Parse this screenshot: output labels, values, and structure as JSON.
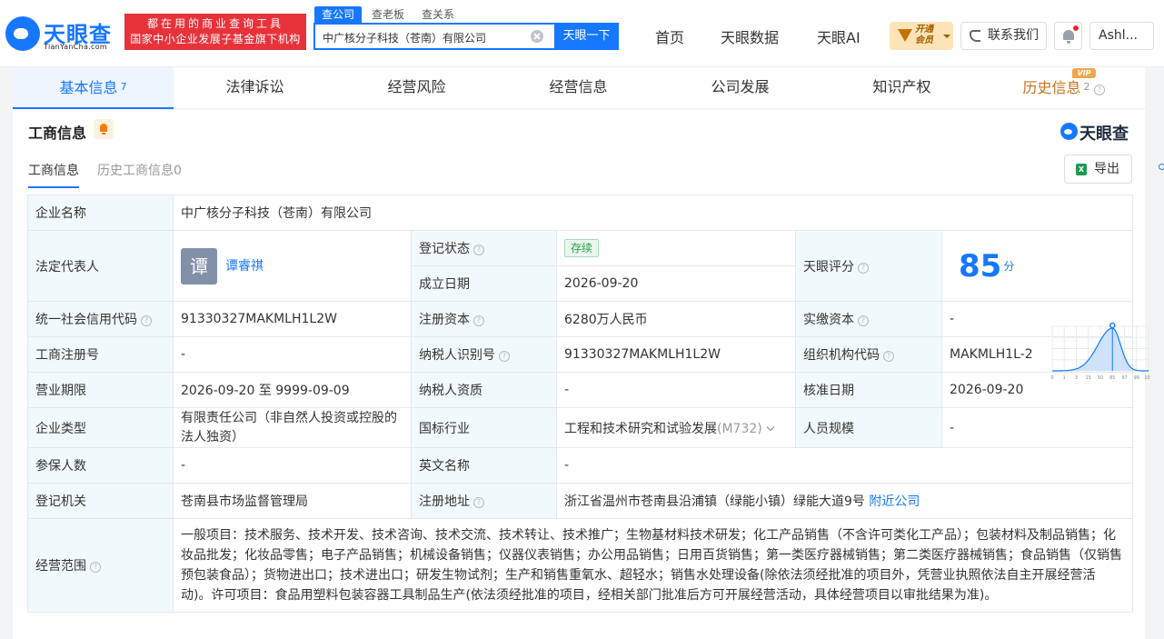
{
  "brand": {
    "name": "天眼查",
    "domain": "TianYanCha.com",
    "slogan_line1": "都在用的商业查询工具",
    "slogan_line2": "国家中小企业发展子基金旗下机构"
  },
  "search": {
    "tabs": [
      "查公司",
      "查老板",
      "查关系"
    ],
    "value": "中广核分子科技（苍南）有限公司",
    "button": "天眼一下"
  },
  "nav": {
    "links": [
      "首页",
      "天眼数据",
      "天眼AI"
    ],
    "vip_line1": "开通",
    "vip_line2": "会员",
    "contact": "联系我们",
    "user": "Ashl..."
  },
  "main_tabs": [
    {
      "label": "基本信息",
      "count": "7"
    },
    {
      "label": "法律诉讼",
      "count": ""
    },
    {
      "label": "经营风险",
      "count": ""
    },
    {
      "label": "经营信息",
      "count": ""
    },
    {
      "label": "公司发展",
      "count": ""
    },
    {
      "label": "知识产权",
      "count": ""
    },
    {
      "label": "历史信息",
      "count": "2"
    }
  ],
  "vip_tag": "VIP",
  "section": {
    "title": "工商信息",
    "sub_tab_active": "工商信息",
    "sub_tab_history": "历史工商信息0",
    "export": "导出",
    "excel_glyph": "X"
  },
  "info": {
    "company_name_label": "企业名称",
    "company_name": "中广核分子科技（苍南）有限公司",
    "legal_rep_label": "法定代表人",
    "legal_rep_avatar": "谭",
    "legal_rep": "谭睿祺",
    "reg_status_label": "登记状态",
    "reg_status": "存续",
    "found_date_label": "成立日期",
    "found_date": "2026-09-20",
    "score_label": "天眼评分",
    "score": "85",
    "score_unit": "分",
    "credit_code_label": "统一社会信用代码",
    "credit_code": "91330327MAKMLH1L2W",
    "reg_capital_label": "注册资本",
    "reg_capital": "6280万人民币",
    "paid_capital_label": "实缴资本",
    "paid_capital": "-",
    "reg_no_label": "工商注册号",
    "reg_no": "-",
    "taxpayer_id_label": "纳税人识别号",
    "taxpayer_id": "91330327MAKMLH1L2W",
    "org_code_label": "组织机构代码",
    "org_code": "MAKMLH1L-2",
    "term_label": "营业期限",
    "term": "2026-09-20 至 9999-09-09",
    "taxpayer_qual_label": "纳税人资质",
    "taxpayer_qual": "-",
    "approval_date_label": "核准日期",
    "approval_date": "2026-09-20",
    "type_label": "企业类型",
    "type": "有限责任公司（非自然人投资或控股的法人独资）",
    "industry_label": "国标行业",
    "industry": "工程和技术研究和试验发展",
    "industry_code": "(M732)",
    "staff_size_label": "人员规模",
    "staff_size": "-",
    "insured_label": "参保人数",
    "insured": "-",
    "english_name_label": "英文名称",
    "english_name": "-",
    "authority_label": "登记机关",
    "authority": "苍南县市场监督管理局",
    "address_label": "注册地址",
    "address": "浙江省温州市苍南县沿浦镇（绿能小镇）绿能大道9号",
    "nearby": "附近公司",
    "scope_label": "经营范围",
    "scope": "一般项目：技术服务、技术开发、技术咨询、技术交流、技术转让、技术推广；生物基材料技术研发；化工产品销售（不含许可类化工产品）；包装材料及制品销售；化妆品批发；化妆品零售；电子产品销售；机械设备销售；仪器仪表销售；办公用品销售；日用百货销售；第一类医疗器械销售；第二类医疗器械销售；食品销售（仅销售预包装食品）；货物进出口；技术进出口；研发生物试剂；生产和销售重氧水、超轻水；销售水处理设备(除依法须经批准的项目外，凭营业执照依法自主开展经营活动)。许可项目：食品用塑料包装容器工具制品生产(依法须经批准的项目，经相关部门批准后方可开展经营活动，具体经营项目以审批结果为准)。"
  },
  "score_chart": {
    "x_ticks": [
      "0",
      "1",
      "3",
      "15",
      "50",
      "85",
      "97",
      "99",
      "100"
    ],
    "marker": 85,
    "colors": {
      "curve": "#1677ff",
      "fill": "#cfe2fb"
    }
  }
}
